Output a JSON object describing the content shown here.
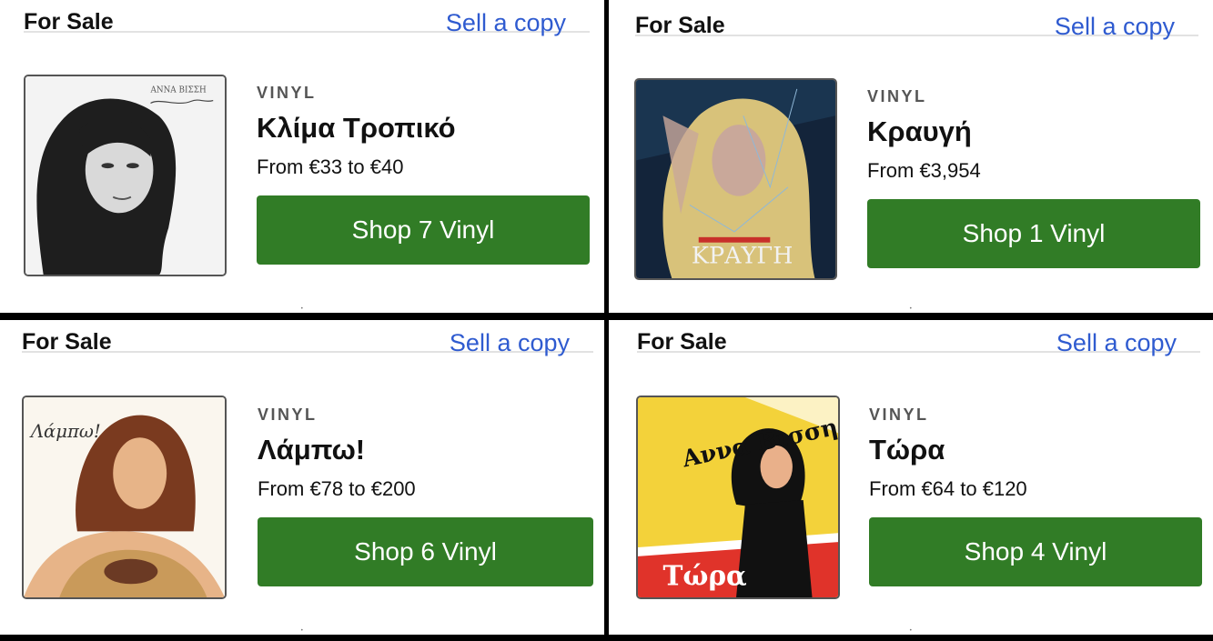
{
  "listings": [
    {
      "for_sale_label": "For Sale",
      "sell_label": "Sell a copy",
      "format": "VINYL",
      "title": "Κλίμα Τροπικό",
      "price": "From €33 to €40",
      "shop_label": "Shop 7 Vinyl",
      "cover_text": "ΑΝΝΑ ΒΙΣΣΗ",
      "cover_colors": {
        "bg": "#f3f3f3",
        "hair": "#1e1e1e",
        "skin": "#d9d9d9"
      }
    },
    {
      "for_sale_label": "For Sale",
      "sell_label": "Sell a copy",
      "format": "VINYL",
      "title": "Κραυγή",
      "price": "From €3,954",
      "shop_label": "Shop 1 Vinyl",
      "cover_text": "ΚΡΑΥΓΗ",
      "cover_colors": {
        "bg": "#13243a",
        "hair": "#d8c27a",
        "skin": "#c9a89a"
      }
    },
    {
      "for_sale_label": "For Sale",
      "sell_label": "Sell a copy",
      "format": "VINYL",
      "title": "Λάμπω!",
      "price": "From €78 to €200",
      "shop_label": "Shop 6 Vinyl",
      "cover_text": "Λάμπω!",
      "cover_colors": {
        "bg": "#faf6ee",
        "hair": "#7a3a1f",
        "skin": "#e7b488"
      }
    },
    {
      "for_sale_label": "For Sale",
      "sell_label": "Sell a copy",
      "format": "VINYL",
      "title": "Τώρα",
      "price": "From €64 to €120",
      "shop_label": "Shop 4 Vinyl",
      "cover_text": "Τώρα",
      "cover_text_2": "Αννα Βισση",
      "cover_colors": {
        "bg": "#f3d23a",
        "hair": "#111111",
        "skin": "#e9b08a",
        "accent": "#e0332a"
      }
    }
  ]
}
